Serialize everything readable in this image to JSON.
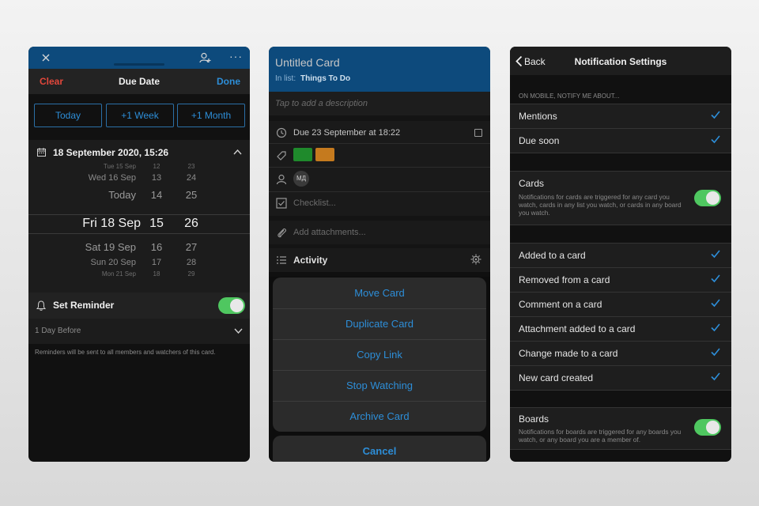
{
  "due_date_screen": {
    "clear": "Clear",
    "title": "Due Date",
    "done": "Done",
    "quick": [
      "Today",
      "+1 Week",
      "+1 Month"
    ],
    "selected_datetime": "18 September 2020, 15:26",
    "wheel": {
      "rows": [
        {
          "day": "Tue 15 Sep",
          "hour": "12",
          "min": "23"
        },
        {
          "day": "Wed 16 Sep",
          "hour": "13",
          "min": "24"
        },
        {
          "day": "Today",
          "hour": "14",
          "min": "25"
        },
        {
          "day": "Fri 18 Sep",
          "hour": "15",
          "min": "26"
        },
        {
          "day": "Sat 19 Sep",
          "hour": "16",
          "min": "27"
        },
        {
          "day": "Sun 20 Sep",
          "hour": "17",
          "min": "28"
        },
        {
          "day": "Mon 21 Sep",
          "hour": "18",
          "min": "29"
        }
      ]
    },
    "reminder_label": "Set Reminder",
    "reminder_on": true,
    "reminder_value": "1 Day Before",
    "reminder_note": "Reminders will be sent to all members and watchers of this card."
  },
  "card_screen": {
    "title": "Untitled Card",
    "in_list_label": "In list:",
    "list_name": "Things To Do",
    "description_placeholder": "Tap to add a description",
    "due": "Due 23 September at 18:22",
    "labels": [
      "#1f8a2c",
      "#c57a1e"
    ],
    "member_initials": "МД",
    "checklist_placeholder": "Checklist...",
    "attachments_placeholder": "Add attachments...",
    "activity": "Activity",
    "actions": [
      "Move Card",
      "Duplicate Card",
      "Copy Link",
      "Stop Watching",
      "Archive Card"
    ],
    "cancel": "Cancel"
  },
  "notification_screen": {
    "back": "Back",
    "title": "Notification Settings",
    "section_mobile": "ON MOBILE, NOTIFY ME ABOUT...",
    "mobile_items": [
      "Mentions",
      "Due soon"
    ],
    "cards_title": "Cards",
    "cards_desc": "Notifications for cards are triggered for any card you watch, cards in any list you watch, or cards in any board you watch.",
    "cards_on": true,
    "card_items": [
      "Added to a card",
      "Removed from a card",
      "Comment on a card",
      "Attachment added to a card",
      "Change made to a card",
      "New card created"
    ],
    "boards_title": "Boards",
    "boards_desc": "Notifications for boards are triggered for any boards you watch, or any board you are a member of.",
    "boards_on": true
  },
  "colors": {
    "header_blue": "#0d4a7c",
    "accent_blue": "#2d8ed8",
    "clear_red": "#e2473b",
    "toggle_green": "#4fc760"
  }
}
